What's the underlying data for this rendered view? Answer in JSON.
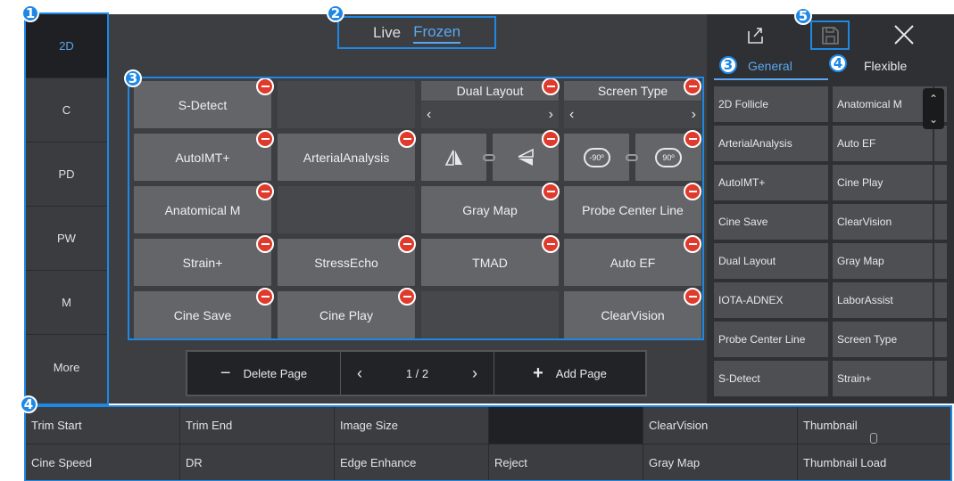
{
  "markers": [
    "1",
    "2",
    "3",
    "3",
    "4",
    "4",
    "5"
  ],
  "modes": [
    "2D",
    "C",
    "PD",
    "PW",
    "M",
    "More"
  ],
  "live_frozen": {
    "live": "Live",
    "frozen": "Frozen"
  },
  "tiles": {
    "s_detect": "S-Detect",
    "dual_layout": "Dual Layout",
    "screen_type": "Screen Type",
    "autoimt": "AutoIMT+",
    "arterial": "ArterialAnalysis",
    "anatomical_m": "Anatomical M",
    "gray_map": "Gray Map",
    "probe_center": "Probe Center Line",
    "strain": "Strain+",
    "stressecho": "StressEcho",
    "tmad": "TMAD",
    "auto_ef": "Auto EF",
    "cine_save": "Cine Save",
    "cine_play": "Cine Play",
    "clearvision": "ClearVision",
    "rot_left": "-90º",
    "rot_right": "90º"
  },
  "pager": {
    "delete": "Delete Page",
    "page": "1 / 2",
    "add": "Add Page"
  },
  "right_tabs": {
    "general": "General",
    "flexible": "Flexible"
  },
  "right_list_col1": [
    "2D Follicle",
    "ArterialAnalysis",
    "AutoIMT+",
    "Cine Save",
    "Dual Layout",
    "IOTA-ADNEX",
    "Probe Center Line",
    "S-Detect"
  ],
  "right_list_col2": [
    "Anatomical M",
    "Auto EF",
    "Cine Play",
    "ClearVision",
    "Gray Map",
    "LaborAssist",
    "Screen Type",
    "Strain+"
  ],
  "bottom_row1": [
    "Trim Start",
    "Trim End",
    "Image Size",
    "",
    "ClearVision",
    "Thumbnail"
  ],
  "bottom_row2": [
    "Cine Speed",
    "DR",
    "Edge Enhance",
    "Reject",
    "Gray Map",
    "Thumbnail Load"
  ],
  "colors": {
    "accent": "#1e88e5",
    "delete": "#e03a2c"
  }
}
